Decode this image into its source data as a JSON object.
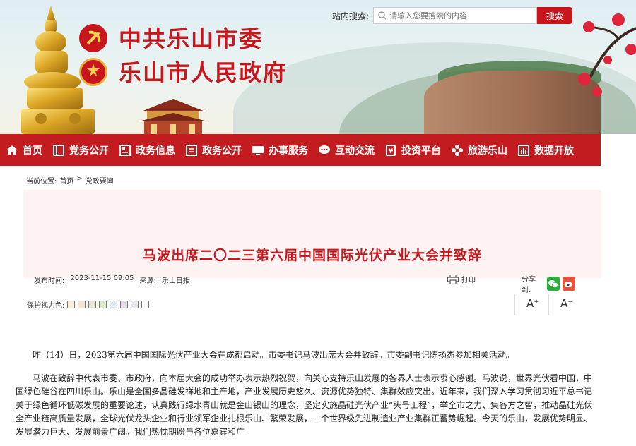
{
  "header": {
    "title_line1": "中共乐山市委",
    "title_line2": "乐山市人民政府",
    "search": {
      "label": "站内搜索:",
      "placeholder": "请输入您要搜索的内容",
      "button": "搜索"
    }
  },
  "nav": {
    "items": [
      {
        "label": "首页",
        "icon": "home-icon"
      },
      {
        "label": "党务公开",
        "icon": "book-icon"
      },
      {
        "label": "政务信息",
        "icon": "news-icon"
      },
      {
        "label": "政务公开",
        "icon": "list-icon"
      },
      {
        "label": "办事服务",
        "icon": "monitor-icon"
      },
      {
        "label": "互动交流",
        "icon": "chat-icon"
      },
      {
        "label": "投资平台",
        "icon": "investment-icon"
      },
      {
        "label": "旅游乐山",
        "icon": "flower-icon"
      },
      {
        "label": "数据开放",
        "icon": "chart-icon"
      }
    ]
  },
  "breadcrumb": {
    "label": "当前位置:",
    "home": "首页",
    "separator": ">",
    "current": "党政要闻"
  },
  "article": {
    "title": "马波出席二〇二三第六届中国国际光伏产业大会并致辞",
    "publish_label": "发布时间:",
    "publish_time": "2023-11-15 09:05",
    "source_label": "来源:",
    "source": "乐山日报",
    "print_label": "打印",
    "share_label": "分享到:",
    "eyecare_label": "保护视力色:",
    "eyecare_colors": [
      "#f5f0d6",
      "#f0e6d2",
      "#e6e6d0",
      "#d8ecc4",
      "#dde8f0",
      "#e8dcec",
      "#e6e6e6",
      "#ffffff"
    ],
    "font_up": "A⁺",
    "font_down": "A⁻",
    "paragraphs": [
      "昨（14）日，2023第六届中国国际光伏产业大会在成都启动。市委书记马波出席大会并致辞。市委副书记陈扬杰参加相关活动。",
      "马波在致辞中代表市委、市政府，向本届大会的成功举办表示热烈祝贺，向关心支持乐山发展的各界人士表示衷心感谢。马波说，世界光伏看中国，中国绿色硅谷在四川乐山。乐山是全国多晶硅发祥地和主产地，产业发展历史悠久、资源优势独特、集群效应突出。近年来，我们深入学习贯彻习近平总书记关于绿色循环低碳发展的重要论述，认真践行绿水青山就是金山银山的理念，坚定实施晶硅光伏产业“头号工程”，举全市之力、集各方之智，推动晶硅光伏全产业链高质量发展，全球光伏龙头企业和行业领军企业扎根乐山、繁荣发展，一个世界级先进制造业产业集群正蓄势崛起。今天的乐山，发展优势明显、发展潜力巨大、发展前景广阔。我们热忱期盼与各位嘉宾和广"
    ]
  },
  "colors": {
    "brand_red": "#c8161d",
    "nav_red": "#c21c21",
    "title_bg": "#fcf3f2",
    "wechat_green": "#2aae3c",
    "weibo_red": "#e8513c"
  }
}
